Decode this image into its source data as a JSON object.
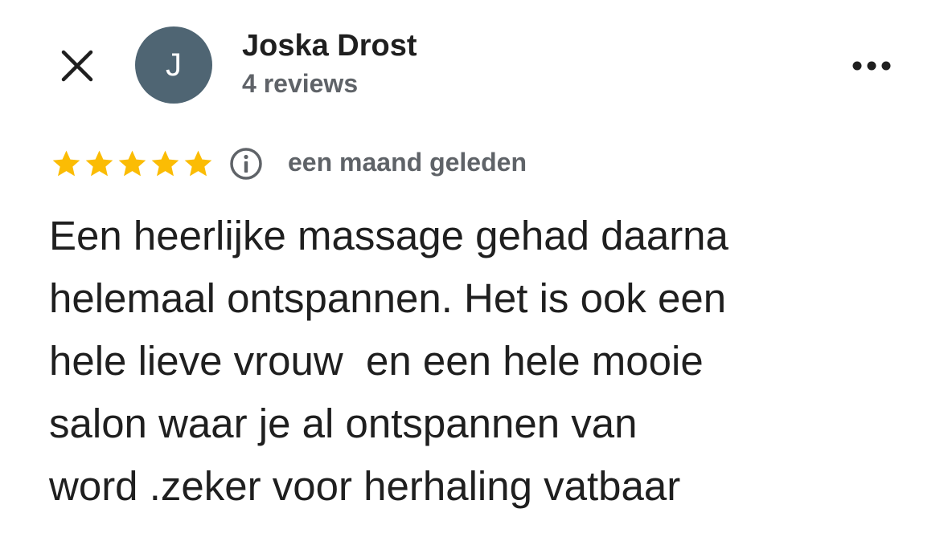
{
  "header": {
    "close_icon": "close-icon",
    "avatar_initial": "J",
    "avatar_color": "#4f6573",
    "reviewer_name": "Joska Drost",
    "review_count": "4 reviews",
    "more_icon": "more-horizontal-icon"
  },
  "review": {
    "rating": 5,
    "rating_max": 5,
    "star_color": "#fbbc04",
    "info_icon": "info-icon",
    "date": "een maand geleden",
    "text": "Een heerlijke massage gehad daarna\nhelemaal ontspannen. Het is ook een\nhele lieve vrouw  en een hele mooie\nsalon waar je al ontspannen van\nword .zeker voor herhaling vatbaar"
  }
}
